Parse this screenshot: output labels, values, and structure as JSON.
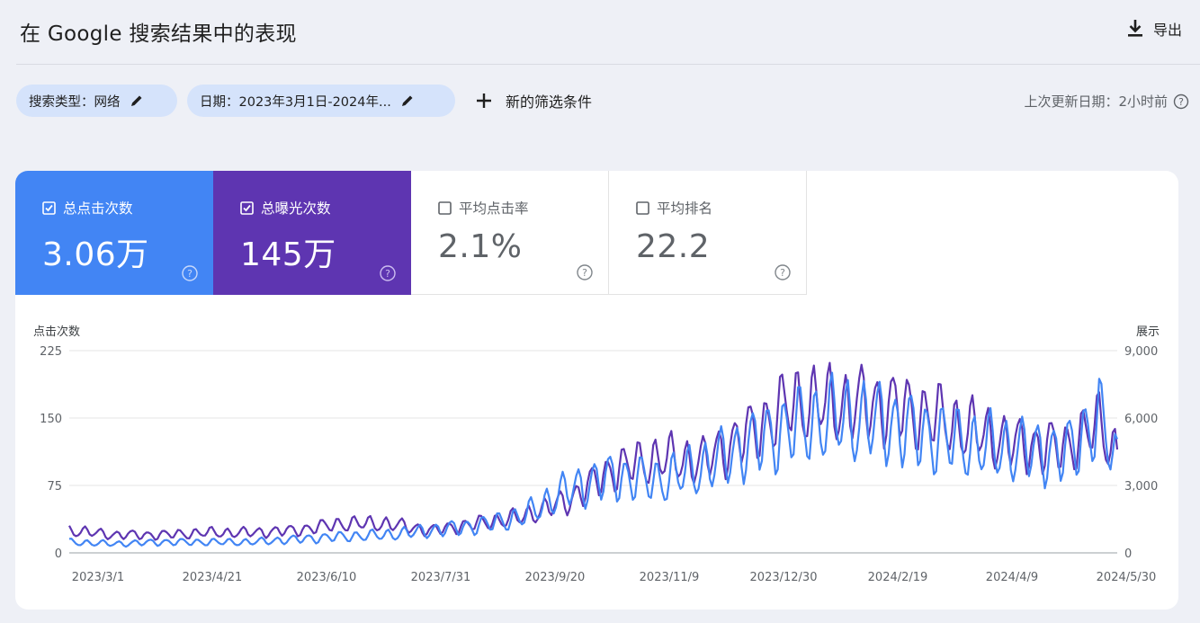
{
  "page": {
    "title": "在 Google 搜索结果中的表现",
    "export_label": "导出"
  },
  "filters": {
    "search_type": "搜索类型：网络",
    "date": "日期：2023年3月1日-2024年...",
    "add_filter": "新的筛选条件",
    "last_update": "上次更新日期：2小时前"
  },
  "metrics": [
    {
      "label": "总点击次数",
      "value": "3.06万",
      "checked": true,
      "color": "#4285f4"
    },
    {
      "label": "总曝光次数",
      "value": "145万",
      "checked": true,
      "color": "#5e35b1"
    },
    {
      "label": "平均点击率",
      "value": "2.1%",
      "checked": false
    },
    {
      "label": "平均排名",
      "value": "22.2",
      "checked": false
    }
  ],
  "chart_data": {
    "type": "line",
    "left_axis_label": "点击次数",
    "right_axis_label": "展示",
    "left_ylim": [
      0,
      225
    ],
    "right_ylim": [
      0,
      9000
    ],
    "left_ticks": [
      "0",
      "75",
      "150",
      "225"
    ],
    "right_ticks": [
      "0",
      "3,000",
      "6,000",
      "9,000"
    ],
    "x_tick_labels": [
      "2023/3/1",
      "2023/4/21",
      "2023/6/10",
      "2023/7/31",
      "2023/9/20",
      "2023/11/9",
      "2023/12/30",
      "2024/2/19",
      "2024/4/9",
      "2024/5/30"
    ],
    "x_range_days": [
      0,
      463
    ],
    "grid": true,
    "series": [
      {
        "name": "点击次数",
        "axis": "left",
        "color": "#4285f4",
        "x_days": [
          0,
          20,
          40,
          60,
          80,
          100,
          120,
          140,
          160,
          180,
          200,
          220,
          240,
          260,
          280,
          300,
          320,
          340,
          360,
          380,
          400,
          420,
          440,
          455,
          463
        ],
        "values": [
          12,
          10,
          12,
          12,
          12,
          15,
          18,
          20,
          25,
          30,
          40,
          70,
          85,
          80,
          95,
          120,
          140,
          150,
          145,
          130,
          120,
          115,
          110,
          150,
          100
        ]
      },
      {
        "name": "展示",
        "axis": "right",
        "color": "#5e35b1",
        "x_days": [
          0,
          20,
          40,
          60,
          80,
          100,
          120,
          140,
          160,
          180,
          200,
          220,
          240,
          260,
          280,
          300,
          320,
          340,
          360,
          380,
          400,
          420,
          440,
          455,
          463
        ],
        "values": [
          1000,
          800,
          800,
          900,
          900,
          1000,
          1300,
          1300,
          1000,
          1300,
          1600,
          2300,
          3700,
          4200,
          4100,
          5300,
          6700,
          6600,
          6600,
          6100,
          5400,
          4800,
          4700,
          5700,
          4400
        ]
      }
    ]
  }
}
